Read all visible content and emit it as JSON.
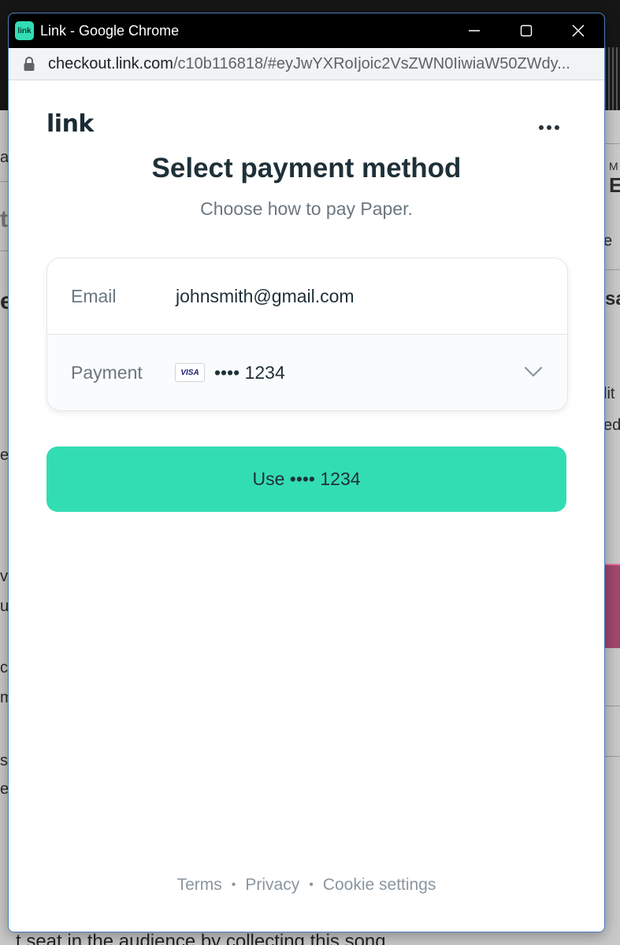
{
  "window": {
    "app_icon_text": "link",
    "title": "Link - Google Chrome"
  },
  "address_bar": {
    "host": "checkout.link.com",
    "path": "/c10b116818/#eyJwYXRoIjoic2VsZWN0IiwiaW50ZWdy..."
  },
  "header": {
    "logo": "link",
    "more_icon": "more-horizontal-icon"
  },
  "main": {
    "title": "Select payment method",
    "subtitle": "Choose how to pay Paper."
  },
  "card": {
    "email_label": "Email",
    "email_value": "johnsmith@gmail.com",
    "payment_label": "Payment",
    "card_brand": "VISA",
    "card_number": "•••• 1234"
  },
  "use_button": {
    "label": "Use •••• 1234"
  },
  "footer": {
    "links": [
      "Terms",
      "Privacy",
      "Cookie settings"
    ],
    "separator": "•"
  },
  "background_page": {
    "fragments": [
      "a",
      "t",
      "e",
      "e",
      "vi",
      "u",
      "c",
      "m",
      "s",
      "e",
      "M",
      "E",
      "e",
      "sa",
      "lit",
      "ed"
    ],
    "footer_text": "t seat in the audience by collecting this song."
  },
  "colors": {
    "accent": "#33ddb3",
    "heading": "#1f3038",
    "muted": "#6b7780",
    "titlebar": "#000000"
  }
}
